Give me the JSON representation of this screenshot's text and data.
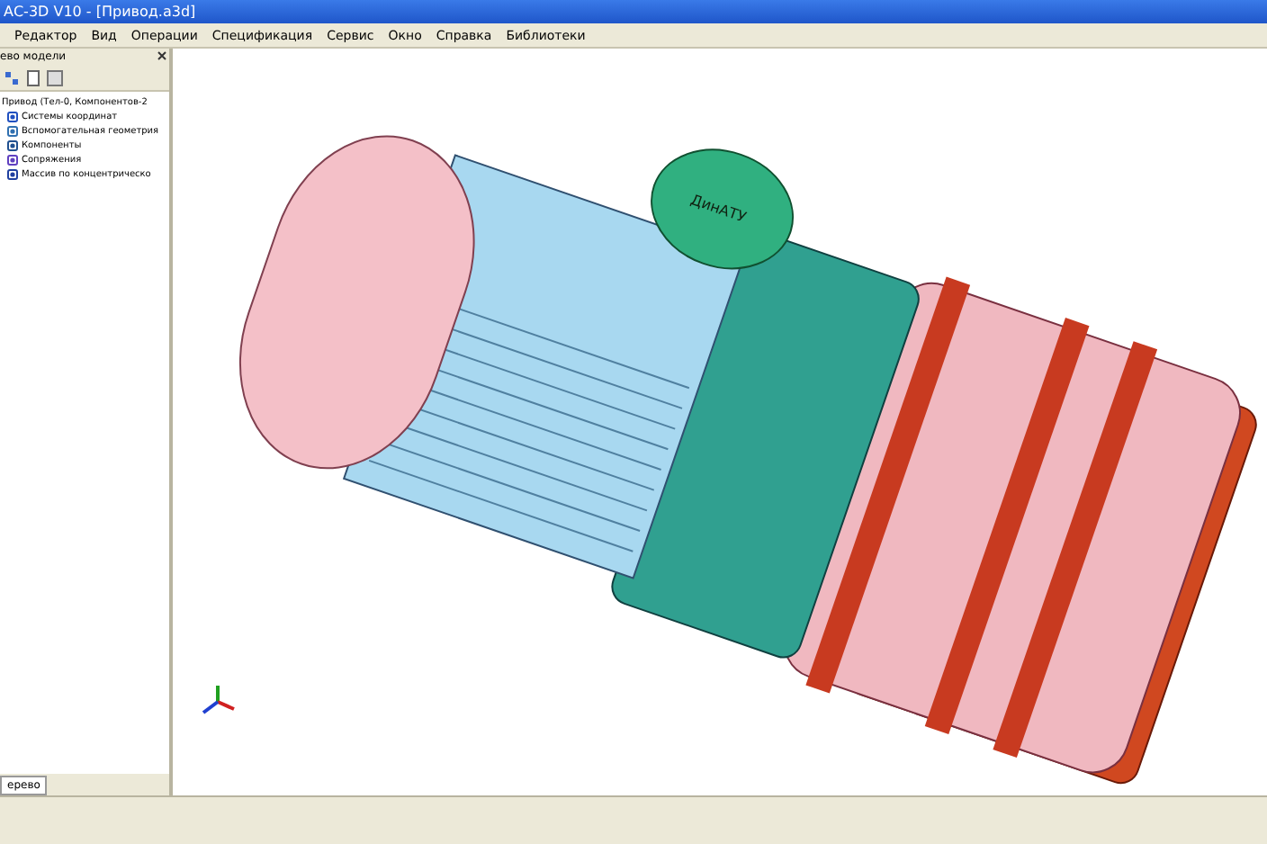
{
  "window": {
    "title": "АС-3D V10 - [Привод.a3d]"
  },
  "menu": [
    "Редактор",
    "Вид",
    "Операции",
    "Спецификация",
    "Сервис",
    "Окно",
    "Справка",
    "Библиотеки"
  ],
  "tree_panel": {
    "title": "ево модели",
    "root": "Привод (Тел-0, Компонентов-2",
    "items": [
      {
        "label": "Системы координат",
        "kind": "axes"
      },
      {
        "label": "Вспомогательная геометрия",
        "kind": "geometry"
      },
      {
        "label": "Компоненты",
        "kind": "parts"
      },
      {
        "label": "Сопряжения",
        "kind": "mates"
      },
      {
        "label": "Массив по концентрическо",
        "kind": "array"
      }
    ],
    "bottom_tab": "ерево"
  },
  "viewport": {
    "nameplate": "ДинАТУ"
  }
}
